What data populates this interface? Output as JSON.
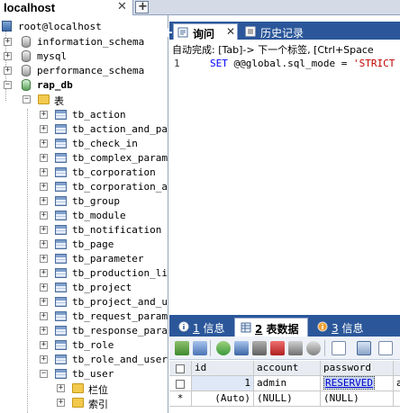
{
  "connection_tab": {
    "title": "localhost",
    "close": "✕",
    "add": "+"
  },
  "tree": {
    "root": "root@localhost",
    "databases": [
      "information_schema",
      "mysql",
      "performance_schema"
    ],
    "open_db": "rap_db",
    "tables_folder": "表",
    "tables": [
      "tb_action",
      "tb_action_and_page",
      "tb_check_in",
      "tb_complex_paramet",
      "tb_corporation",
      "tb_corporation_and",
      "tb_group",
      "tb_module",
      "tb_notification",
      "tb_page",
      "tb_parameter",
      "tb_production_line",
      "tb_project",
      "tb_project_and_use",
      "tb_request_paramet",
      "tb_response_parame",
      "tb_role",
      "tb_role_and_user",
      "tb_user"
    ],
    "user_children": [
      "栏位",
      "索引"
    ]
  },
  "query_tabs": [
    {
      "label": "询问",
      "active": true,
      "close": "✕"
    },
    {
      "label": "历史记录",
      "active": false
    }
  ],
  "query_add": "+",
  "editor": {
    "autocomplete_hint": "自动完成: [Tab]-> 下一个标签, [Ctrl+Space",
    "line_number": "1",
    "code_kw": "SET",
    "code_var": "@@global.sql_mode",
    "code_eq": "=",
    "code_str": "'STRICT"
  },
  "result_tabs": [
    {
      "num": "1",
      "label": "信息",
      "active": false
    },
    {
      "num": "2",
      "label": "表数据",
      "active": true
    },
    {
      "num": "3",
      "label": "信息",
      "active": false
    }
  ],
  "grid": {
    "columns": [
      "id",
      "account",
      "password",
      ""
    ],
    "rows": [
      {
        "id": "1",
        "account": "admin",
        "password": "RESERVED",
        "extra": "a"
      },
      {
        "id": "(Auto)",
        "account": "(NULL)",
        "password": "(NULL)",
        "extra": ""
      }
    ],
    "new_row_marker": "*"
  },
  "colors": {
    "tab_bar_blue": "#2b579a",
    "keyword": "#0000ff",
    "string": "#c00000"
  }
}
